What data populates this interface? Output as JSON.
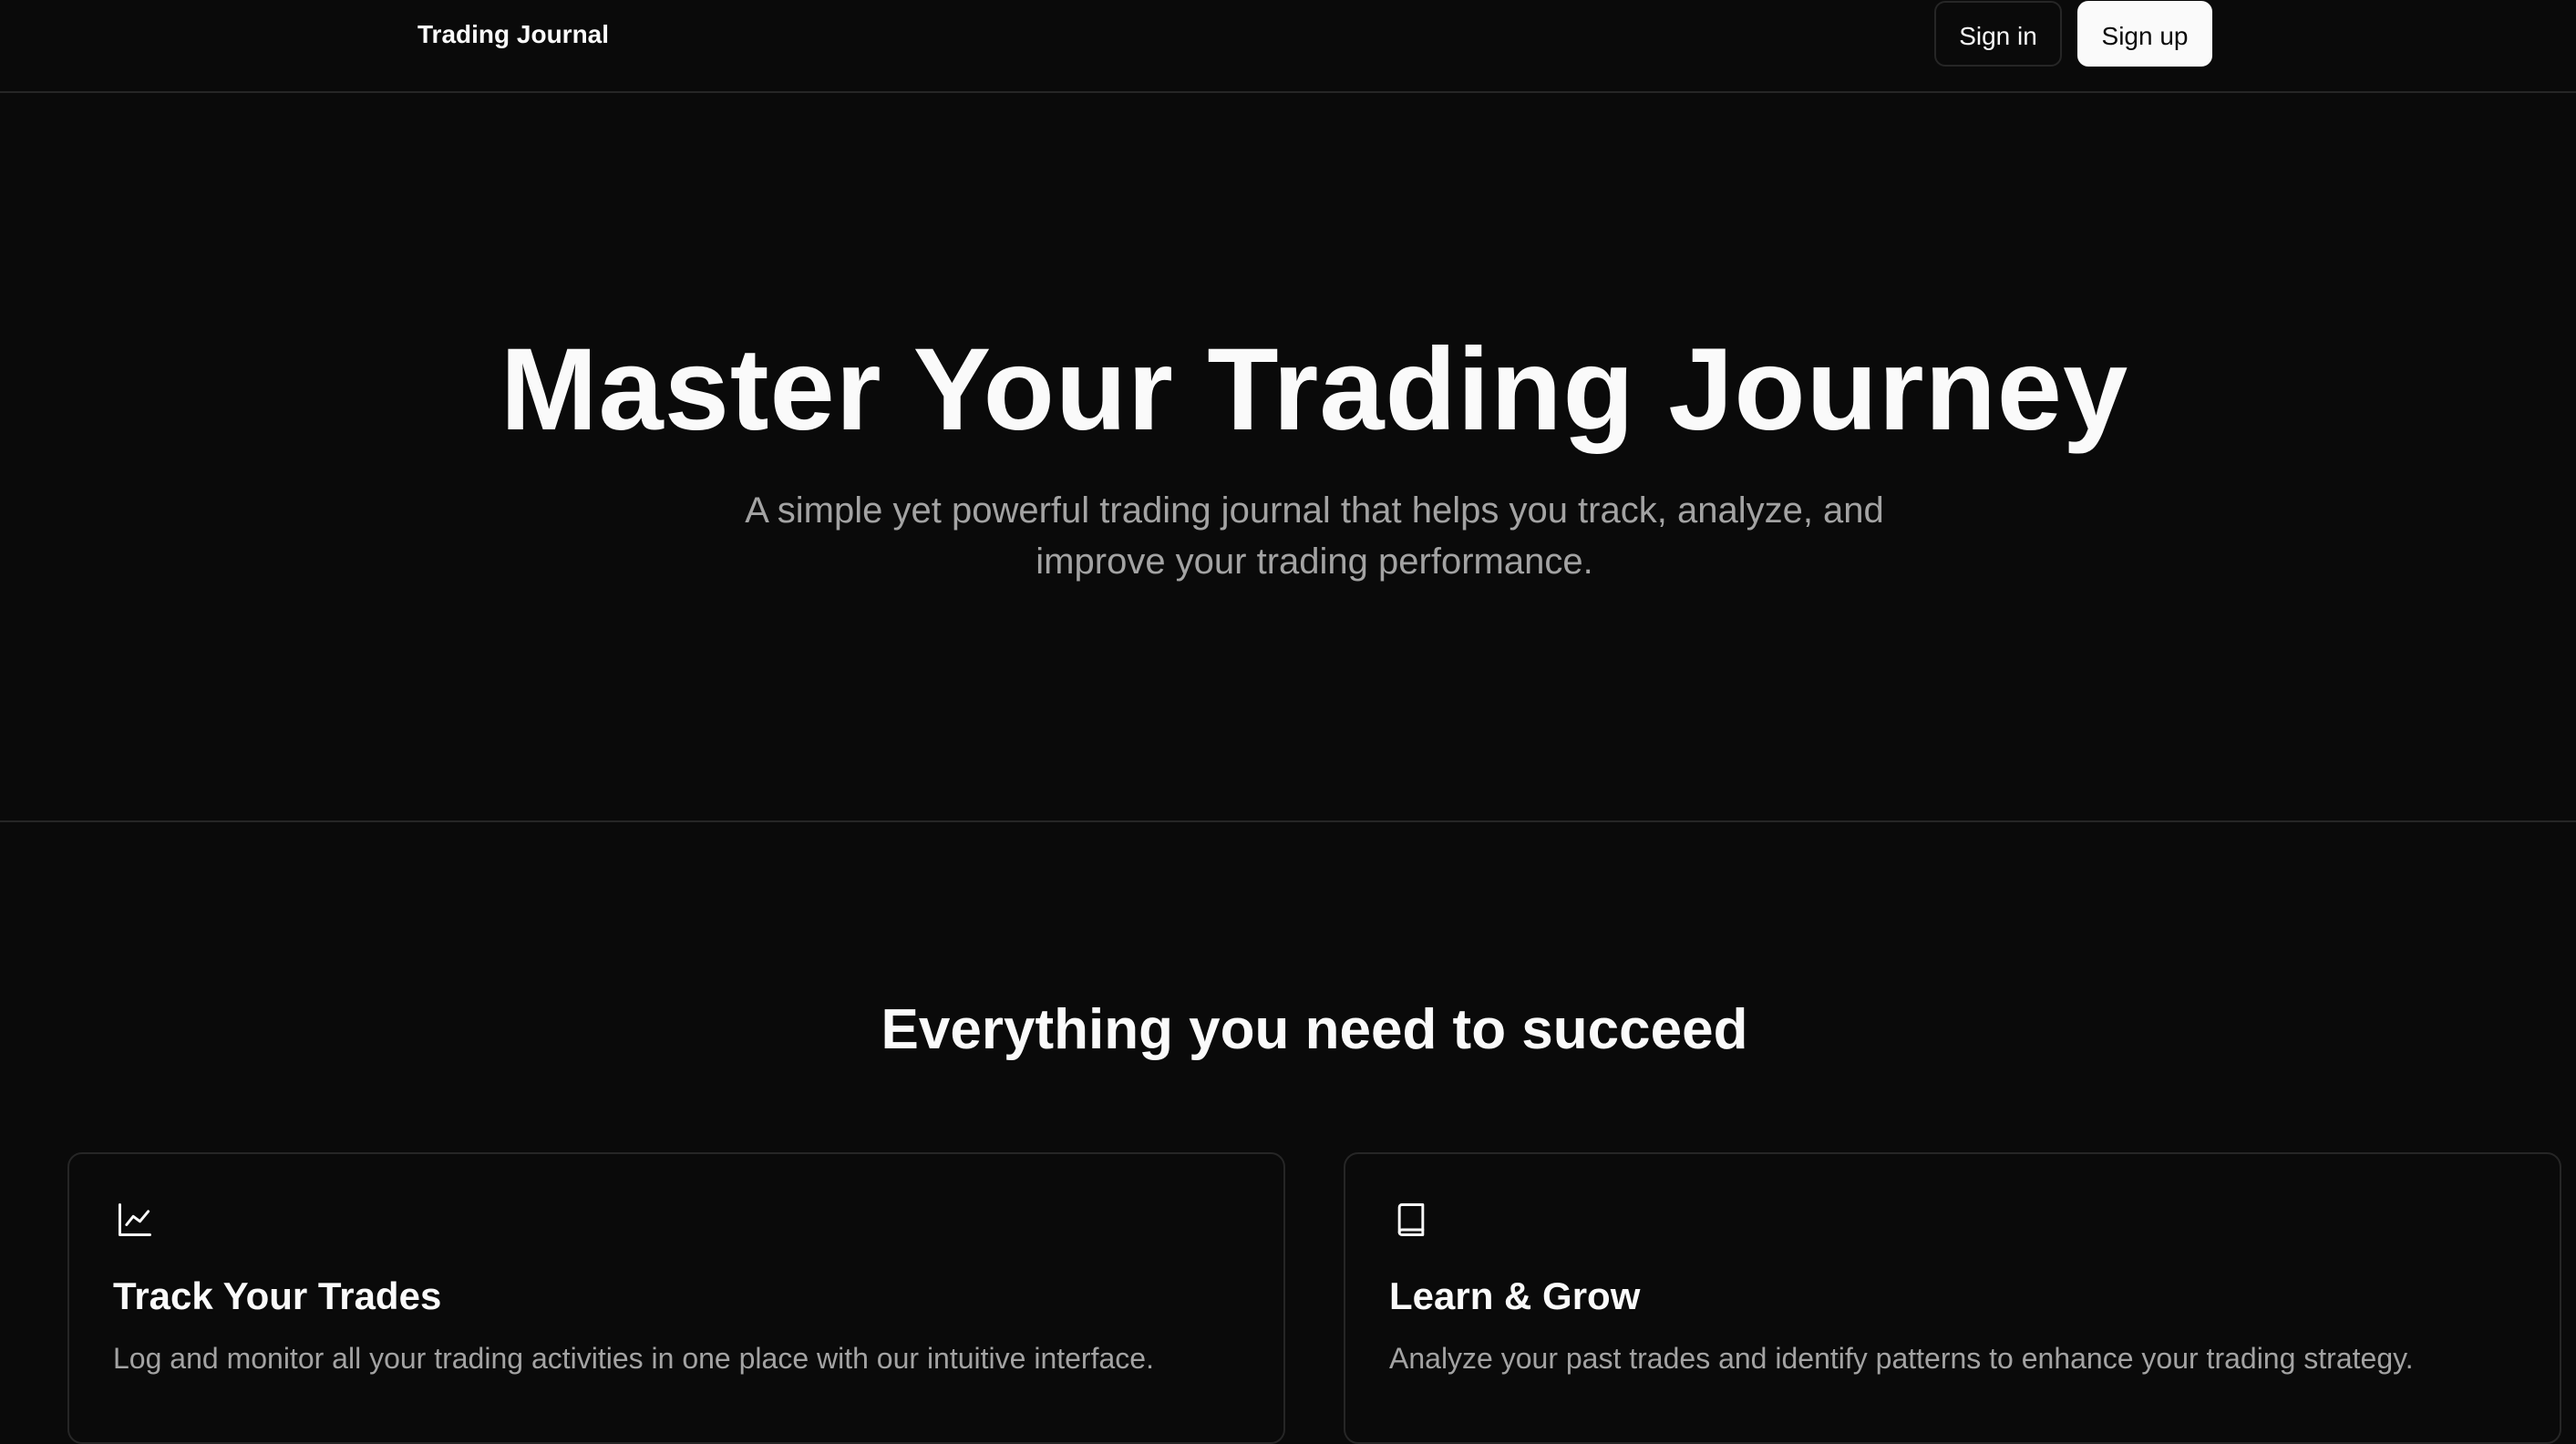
{
  "header": {
    "brand": "Trading Journal",
    "sign_in_label": "Sign in",
    "sign_up_label": "Sign up"
  },
  "hero": {
    "title": "Master Your Trading Journey",
    "subtitle": "A simple yet powerful trading journal that helps you track, analyze, and improve your trading performance."
  },
  "features": {
    "title": "Everything you need to succeed",
    "cards": [
      {
        "icon": "line-chart-icon",
        "title": "Track Your Trades",
        "description": "Log and monitor all your trading activities in one place with our intuitive interface."
      },
      {
        "icon": "book-icon",
        "title": "Learn & Grow",
        "description": "Analyze your past trades and identify patterns to enhance your trading strategy."
      }
    ]
  },
  "colors": {
    "background": "#0a0a0a",
    "foreground": "#fafafa",
    "muted": "#a3a3a3",
    "border": "#262626"
  }
}
